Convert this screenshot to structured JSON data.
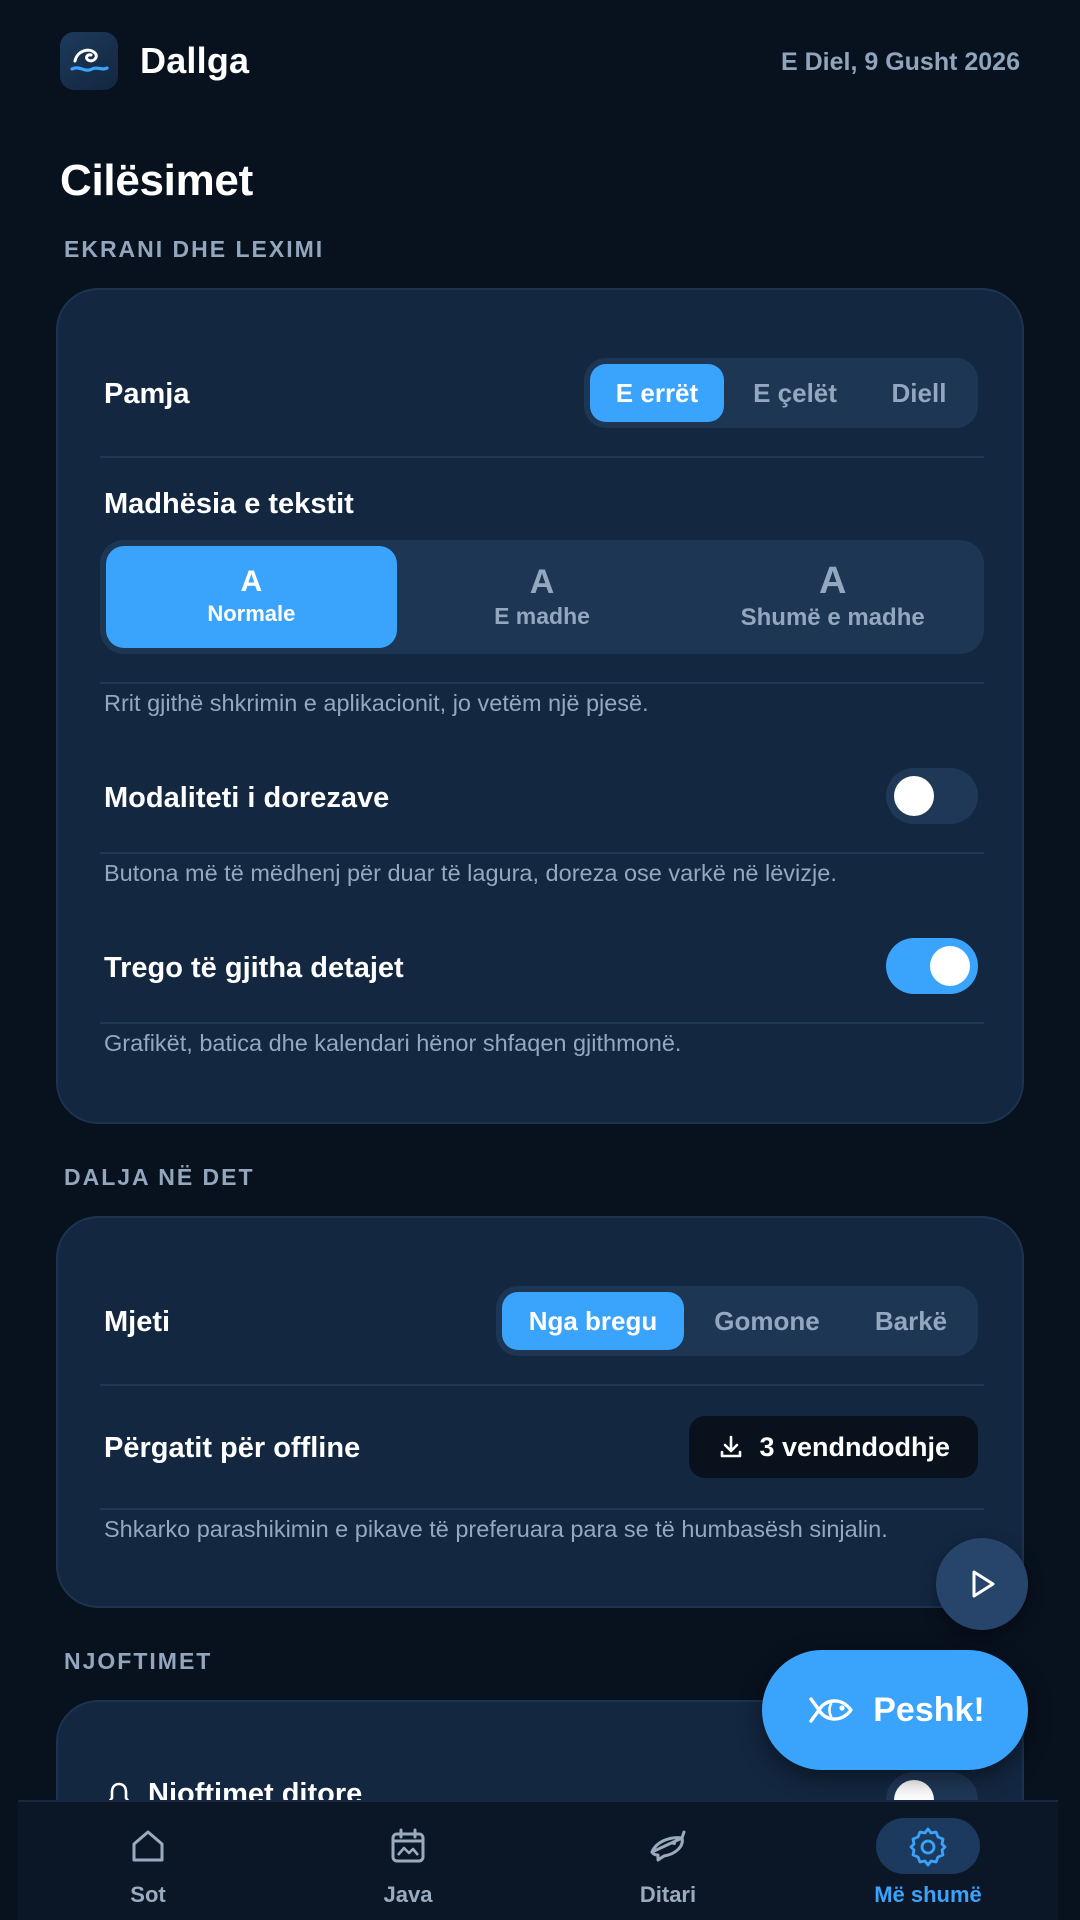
{
  "header": {
    "app_name": "Dallga",
    "date": "E Diel, 9 Gusht 2026",
    "logo_icon": "wave-icon"
  },
  "page": {
    "title": "Cilësimet"
  },
  "sections": {
    "display": {
      "label": "EKRANI DHE LEXIMI",
      "theme": {
        "label": "Pamja",
        "options": [
          "E errët",
          "E çelët",
          "Diell"
        ],
        "selected": "E errët"
      },
      "text_size": {
        "label": "Madhësia e tekstit",
        "options": [
          {
            "glyph": "A",
            "name": "Normale"
          },
          {
            "glyph": "A",
            "name": "E madhe"
          },
          {
            "glyph": "A",
            "name": "Shumë e madhe"
          }
        ],
        "selected": "Normale",
        "help": "Rrit gjithë shkrimin e aplikacionit, jo vetëm një pjesë."
      },
      "gloves": {
        "label": "Modaliteti i dorezave",
        "enabled": false,
        "help": "Butona më të mëdhenj për duar të lagura, doreza ose varkë në lëvizje."
      },
      "details": {
        "label": "Trego të gjitha detajet",
        "enabled": true,
        "help": "Grafikët, batica dhe kalendari hënor shfaqen gjithmonë."
      }
    },
    "sea": {
      "label": "DALJA NË DET",
      "vessel": {
        "label": "Mjeti",
        "options": [
          "Nga bregu",
          "Gomone",
          "Barkë"
        ],
        "selected": "Nga bregu"
      },
      "offline": {
        "label": "Përgatit për offline",
        "button": "3 vendndodhje",
        "help": "Shkarko parashikimin e pikave të preferuara para se të humbasësh sinjalin."
      }
    },
    "notifications": {
      "label": "NJOFTIMET",
      "daily": {
        "label": "Njoftimet ditore",
        "enabled": false
      }
    }
  },
  "fab": {
    "play_icon": "play-icon",
    "catch_label": "Peshk!",
    "catch_icon": "fish-icon"
  },
  "nav": {
    "items": [
      {
        "label": "Sot",
        "icon": "home-icon"
      },
      {
        "label": "Java",
        "icon": "calendar-icon"
      },
      {
        "label": "Ditari",
        "icon": "fish-journal-icon"
      },
      {
        "label": "Më shumë",
        "icon": "gear-icon"
      }
    ],
    "active": "Më shumë"
  },
  "colors": {
    "accent": "#3aa3fb",
    "background": "#08111e",
    "card": "#132741"
  }
}
